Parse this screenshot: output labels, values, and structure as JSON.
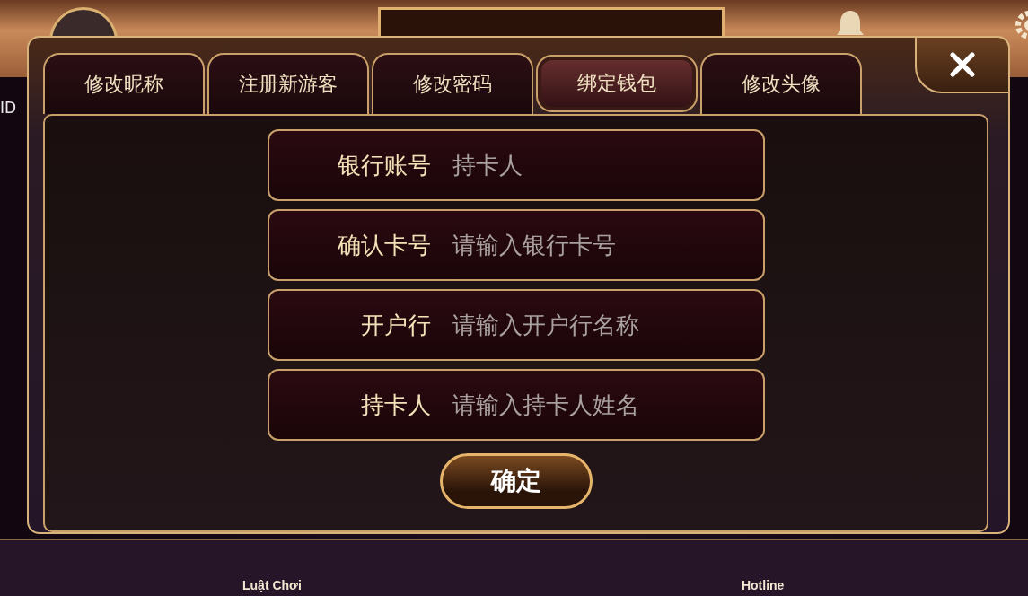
{
  "background": {
    "id_label": "ID",
    "bottom_nav": [
      {
        "label": "Luật Chơi"
      },
      {
        "label": "Hotline"
      }
    ]
  },
  "dialog": {
    "tabs": [
      {
        "label": "修改昵称",
        "selected": false
      },
      {
        "label": "注册新游客",
        "selected": false
      },
      {
        "label": "修改密码",
        "selected": false
      },
      {
        "label": "绑定钱包",
        "selected": true
      },
      {
        "label": "修改头像",
        "selected": false
      }
    ],
    "fields": [
      {
        "label": "银行账号",
        "placeholder": "持卡人"
      },
      {
        "label": "确认卡号",
        "placeholder": "请输入银行卡号"
      },
      {
        "label": "开户行",
        "placeholder": "请输入开户行名称"
      },
      {
        "label": "持卡人",
        "placeholder": "请输入持卡人姓名"
      }
    ],
    "confirm_button": "确定"
  }
}
